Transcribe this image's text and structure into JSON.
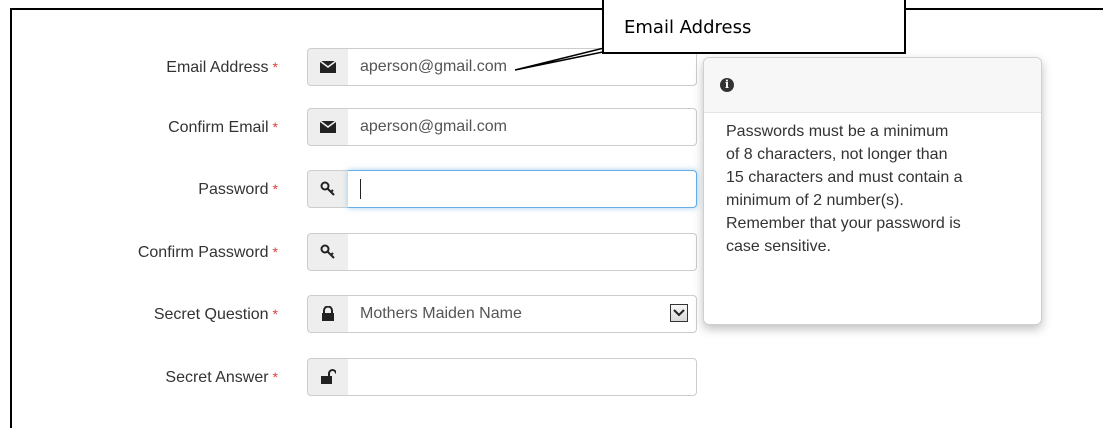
{
  "callout": {
    "text": "Email Address"
  },
  "form": {
    "required_mark": "*",
    "fields": [
      {
        "label": "Email Address",
        "icon": "envelope-icon",
        "value": "aperson@gmail.com"
      },
      {
        "label": "Confirm Email",
        "icon": "envelope-icon",
        "value": "aperson@gmail.com"
      },
      {
        "label": "Password",
        "icon": "key-icon",
        "value": ""
      },
      {
        "label": "Confirm Password",
        "icon": "key-icon",
        "value": ""
      },
      {
        "label": "Secret Question",
        "icon": "lock-icon",
        "value": "Mothers Maiden Name"
      },
      {
        "label": "Secret Answer",
        "icon": "unlock-icon",
        "value": ""
      }
    ]
  },
  "popover": {
    "icon": "info-icon",
    "lines": [
      "Passwords must be a minimum",
      "of 8 characters, not longer than",
      "15 characters and must contain a",
      "minimum of 2 number(s).",
      "Remember that your password is",
      "case sensitive."
    ]
  },
  "colors": {
    "required": "#e0403a",
    "focus_border": "#66afe9",
    "addon_bg": "#eeeeee"
  }
}
